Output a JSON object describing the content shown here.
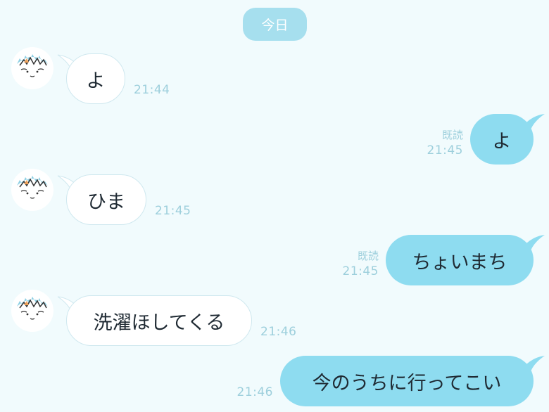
{
  "date_label": "今日",
  "messages": [
    {
      "direction": "in",
      "text": "よ",
      "time": "21:44"
    },
    {
      "direction": "out",
      "text": "よ",
      "time": "21:45",
      "read": "既読"
    },
    {
      "direction": "in",
      "text": "ひま",
      "time": "21:45"
    },
    {
      "direction": "out",
      "text": "ちょいまち",
      "time": "21:45",
      "read": "既読"
    },
    {
      "direction": "in",
      "text": "洗濯ほしてくる",
      "time": "21:46"
    },
    {
      "direction": "out",
      "text": "今のうちに行ってこい",
      "time": "21:46"
    }
  ],
  "colors": {
    "background": "#f1fbfd",
    "outgoing_bubble": "#8edcf0",
    "incoming_bubble": "#ffffff",
    "meta_text": "#9dcfdc",
    "date_pill": "#a6dfee"
  },
  "icons": {
    "avatar": "cartoon-character-avatar-icon"
  }
}
